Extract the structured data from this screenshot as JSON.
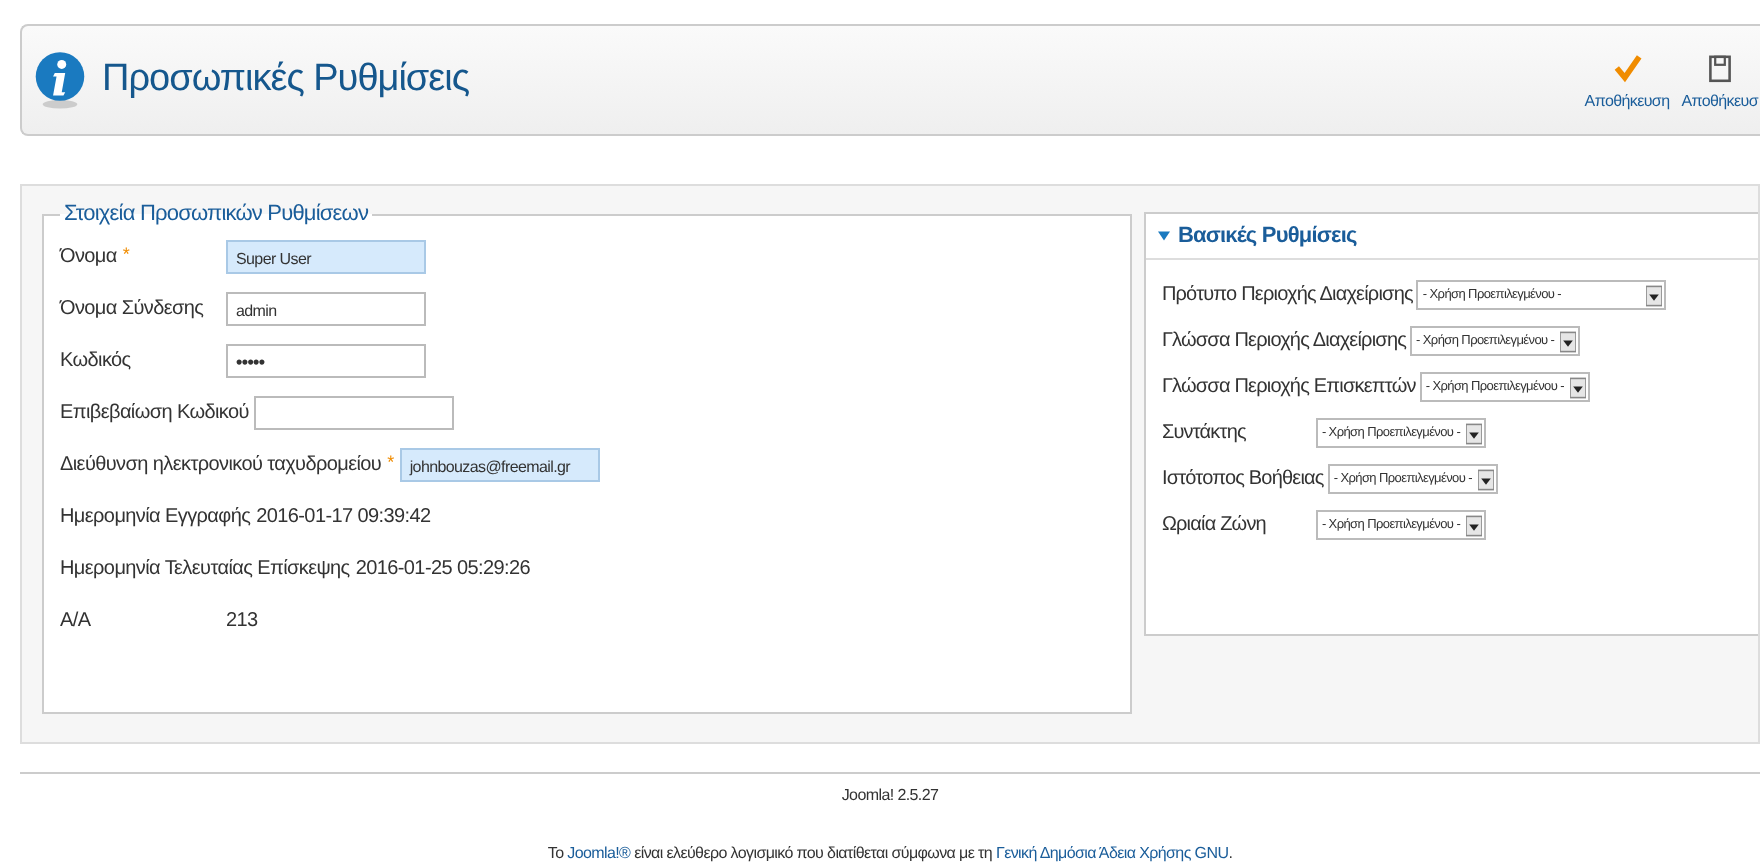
{
  "header": {
    "title": "Προσωπικές Ρυθμίσεις",
    "actions": [
      {
        "kind": "check",
        "label": "Αποθήκευση"
      },
      {
        "kind": "disk",
        "label": "Αποθήκευσ"
      }
    ]
  },
  "personal": {
    "legend": "Στοιχεία Προσωπικών Ρυθμίσεων",
    "fields": [
      {
        "kind": "input",
        "label": "Όνομα",
        "required_mark": "*",
        "value": "Super User",
        "highlighted": true
      },
      {
        "kind": "input",
        "label": "Όνομα Σύνδεσης",
        "value": "admin",
        "highlighted": false
      },
      {
        "kind": "password",
        "label": "Κωδικός",
        "value": "•••••",
        "highlighted": false
      },
      {
        "kind": "input",
        "label": "Επιβεβαίωση Κωδικού",
        "highlighted": false
      },
      {
        "kind": "input",
        "label": "Διεύθυνση ηλεκτρονικού ταχυδρομείου",
        "required_mark": "*",
        "value": "johnbouzas@freemail.gr",
        "highlighted": true
      },
      {
        "kind": "info",
        "label": "Ημερομηνία Εγγραφής",
        "value": "2016-01-17 09:39:42"
      },
      {
        "kind": "info",
        "label": "Ημερομηνία Τελευταίας Επίσκεψης",
        "value": "2016-01-25 05:29:26"
      },
      {
        "kind": "info",
        "label": "Α/Α",
        "value": "213"
      }
    ]
  },
  "basic": {
    "title": "Βασικές Ρυθμίσεις",
    "expanded": true,
    "settings": [
      {
        "label": "Πρότυπο Περιοχής Διαχείρισης",
        "value": "- Χρήση Προεπιλεγμένου -",
        "wide": true
      },
      {
        "label": "Γλώσσα Περιοχής Διαχείρισης",
        "value": "- Χρήση Προεπιλεγμένου -",
        "wide": false
      },
      {
        "label": "Γλώσσα Περιοχής Επισκεπτών",
        "value": "- Χρήση Προεπιλεγμένου -",
        "wide": false
      },
      {
        "label": "Συντάκτης",
        "value": "- Χρήση Προεπιλεγμένου -",
        "wide": false
      },
      {
        "label": "Ιστότοπος Βοήθειας",
        "value": "- Χρήση Προεπιλεγμένου -",
        "wide": false
      },
      {
        "label": "Ωριαία Ζώνη",
        "value": "- Χρήση Προεπιλεγμένου -",
        "wide": false
      }
    ]
  },
  "footer": {
    "version": "Joomla! 2.5.27",
    "license": {
      "before": "Το",
      "link1": "Joomla!®",
      "middle": "είναι ελεύθερο λογισμικό που διατίθεται σύμφωνα με τη",
      "link2": "Γενική Δημόσια Άδεια Χρήσης GNU",
      "after": "."
    }
  }
}
